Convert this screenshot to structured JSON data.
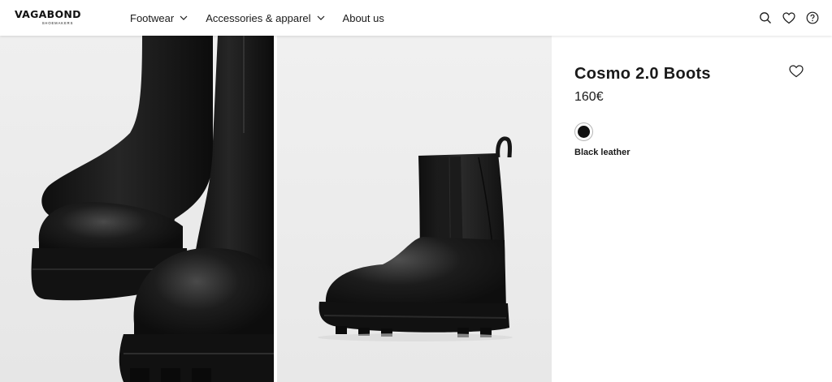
{
  "brand": {
    "name": "VAGABOND",
    "tagline": "SHOEMAKERS"
  },
  "nav": {
    "items": [
      {
        "label": "Footwear",
        "has_dropdown": true
      },
      {
        "label": "Accessories & apparel",
        "has_dropdown": true
      },
      {
        "label": "About us",
        "has_dropdown": false
      }
    ]
  },
  "header_icons": [
    "search-icon",
    "heart-icon",
    "help-icon"
  ],
  "gallery": {
    "images": [
      {
        "subject": "boots-closeup-icon"
      },
      {
        "subject": "boot-side-view-icon"
      }
    ]
  },
  "product": {
    "title": "Cosmo 2.0 Boots",
    "price": "160€",
    "color_name": "Black leather",
    "swatch_color": "#111111"
  },
  "colors": {
    "image_background": "#eeeeee",
    "leather": "#161616",
    "text": "#1a1a1a"
  }
}
